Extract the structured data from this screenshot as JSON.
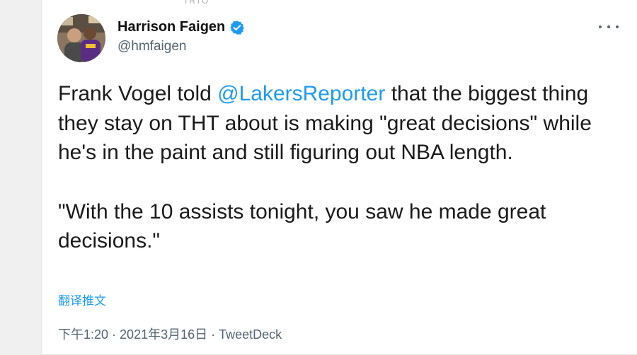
{
  "header": {
    "top_fragment": "TRTO",
    "display_name": "Harrison Faigen",
    "handle": "@hmfaigen",
    "more_icon": "more-horizontal-icon",
    "verified_icon": "verified-badge-icon"
  },
  "tweet": {
    "part1_before_mention": "Frank Vogel told ",
    "mention": "@LakersReporter",
    "part1_after_mention": " that the biggest thing they stay on THT about is making \"great decisions\" while he's in the paint and still figuring out NBA length.",
    "part2": "\"With the 10 assists tonight, you saw he made great decisions.\""
  },
  "translate_label": "翻译推文",
  "meta": {
    "time": "下午1:20",
    "separator1": " · ",
    "date": "2021年3月16日",
    "separator2": " · ",
    "source": "TweetDeck"
  },
  "colors": {
    "link": "#1d9bf0",
    "secondary_text": "#536471",
    "verified": "#1d9bf0"
  }
}
